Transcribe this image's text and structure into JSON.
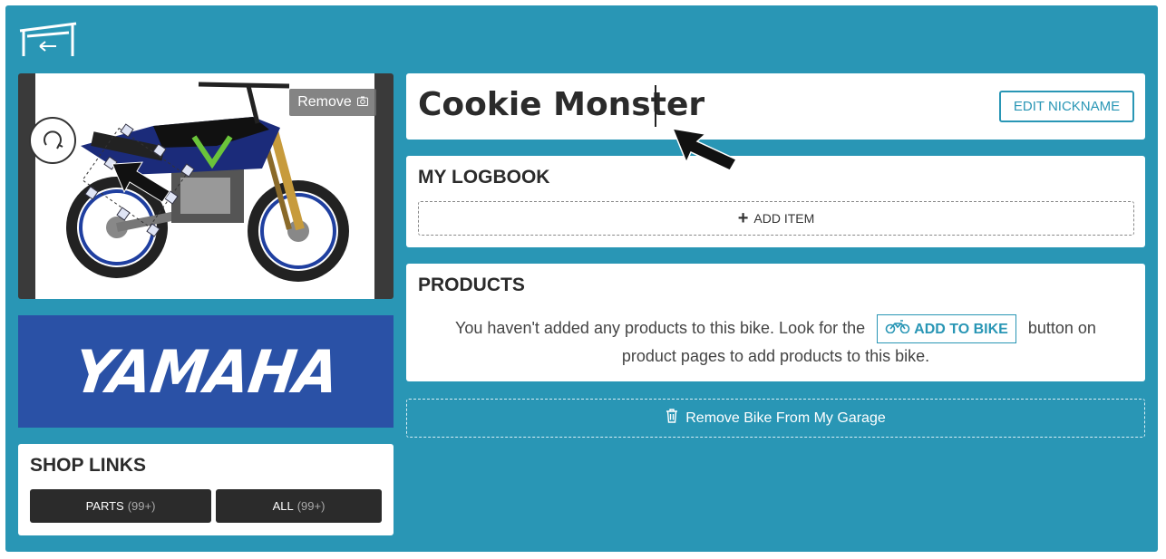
{
  "header": {
    "back_icon": "garage-back-icon"
  },
  "bike_image": {
    "remove_label": "Remove",
    "remove_icon": "camera-icon",
    "rotate_icon": "rotate-icon"
  },
  "brand": {
    "name": "YAMAHA",
    "color": "#2a51a6"
  },
  "shop_links": {
    "title": "SHOP LINKS",
    "parts_label": "PARTS",
    "parts_count": "(99+)",
    "all_label": "ALL",
    "all_count": "(99+)"
  },
  "nickname": {
    "value": "Cookie Monster",
    "edit_label": "EDIT NICKNAME"
  },
  "logbook": {
    "title": "MY LOGBOOK",
    "add_label": "ADD ITEM"
  },
  "products": {
    "title": "PRODUCTS",
    "msg_before": "You haven't added any products to this bike. Look for the",
    "button_label": "ADD TO BIKE",
    "msg_after": "button on product pages to add products to this bike."
  },
  "remove_bike_label": "Remove Bike From My Garage",
  "colors": {
    "background": "#2996b5",
    "accent": "#2996b5",
    "dark": "#2b2b2b"
  }
}
